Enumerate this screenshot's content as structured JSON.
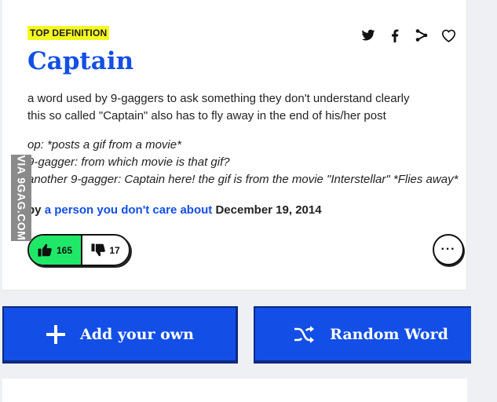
{
  "definition": {
    "badge": "TOP DEFINITION",
    "word": "Captain",
    "meaning_lines": [
      "a word used by 9-gaggers to ask something they don't understand clearly",
      "this so called \"Captain\" also has to fly away in the end of his/her post"
    ],
    "example_lines": [
      "op: *posts a gif from a movie*",
      "9-gagger: from which movie is that gif?",
      "another 9-gagger: Captain here! the gif is from the movie \"Interstellar\" *Flies away*"
    ],
    "by_label": "by",
    "author": "a person you don't care about",
    "date": "December 19, 2014"
  },
  "share": {
    "icons": [
      "twitter-icon",
      "facebook-icon",
      "share-icon",
      "heart-icon"
    ]
  },
  "votes": {
    "up_count": "165",
    "down_count": "17"
  },
  "more": {
    "label": "···"
  },
  "actions": {
    "add_label": "Add your own",
    "random_label": "Random Word"
  },
  "watermark": {
    "text": "VIA 9GAG.COM"
  },
  "colors": {
    "accent": "#134fe6",
    "badge": "#f4f924",
    "upvote": "#1fe868"
  }
}
